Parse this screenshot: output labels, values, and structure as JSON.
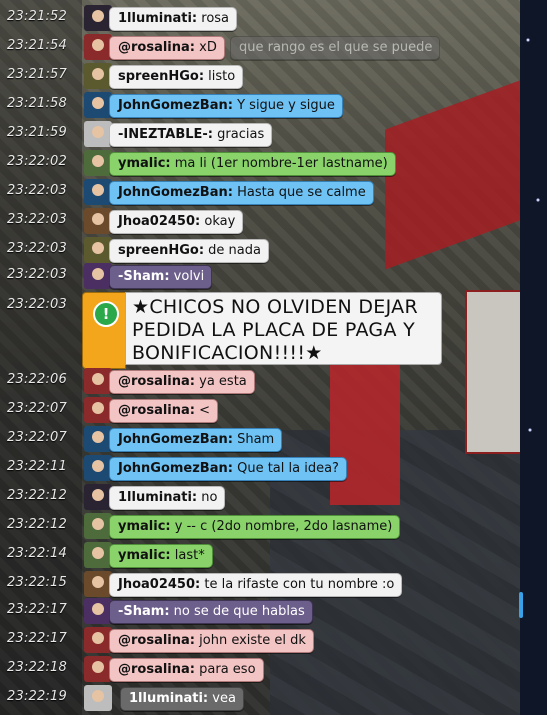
{
  "messages": [
    {
      "time": "23:21:52",
      "user": "1lluminati:",
      "text": "rosa",
      "color": "white"
    },
    {
      "time": "23:21:54",
      "user": "@rosalina:",
      "text": "xD",
      "color": "pink",
      "extra": "que rango es el que se puede"
    },
    {
      "time": "23:21:57",
      "user": "spreenHGo:",
      "text": "listo",
      "color": "white"
    },
    {
      "time": "23:21:58",
      "user": "JohnGomezBan:",
      "text": "Y sigue y sigue",
      "color": "blue"
    },
    {
      "time": "23:21:59",
      "user": "-INEZTABLE-:",
      "text": "gracias",
      "color": "white"
    },
    {
      "time": "23:22:02",
      "user": "ymalic:",
      "text": "ma li (1er nombre-1er lastname)",
      "color": "green"
    },
    {
      "time": "23:22:03",
      "user": "JohnGomezBan:",
      "text": "Hasta que se calme",
      "color": "blue"
    },
    {
      "time": "23:22:03",
      "user": "Jhoa02450:",
      "text": "okay",
      "color": "white"
    },
    {
      "time": "23:22:03",
      "user": "spreenHGo:",
      "text": "de nada",
      "color": "white"
    },
    {
      "time": "23:22:03",
      "user": "-Sham:",
      "text": "volvi",
      "color": "purple"
    }
  ],
  "alert": {
    "time": "23:22:03",
    "icon": "exclamation-icon",
    "text": "★CHICOS NO OLVIDEN DEJAR PEDIDA LA PLACA DE PAGA Y BONIFICACION!!!!★"
  },
  "messages2": [
    {
      "time": "23:22:06",
      "user": "@rosalina:",
      "text": "ya esta",
      "color": "pink"
    },
    {
      "time": "23:22:07",
      "user": "@rosalina:",
      "text": "<",
      "color": "pink"
    },
    {
      "time": "23:22:07",
      "user": "JohnGomezBan:",
      "text": "Sham",
      "color": "blue"
    },
    {
      "time": "23:22:11",
      "user": "JohnGomezBan:",
      "text": "Que tal la idea?",
      "color": "blue"
    },
    {
      "time": "23:22:12",
      "user": "1lluminati:",
      "text": "no",
      "color": "white"
    },
    {
      "time": "23:22:12",
      "user": "ymalic:",
      "text": "y -- c (2do nombre, 2do lasname)",
      "color": "green"
    },
    {
      "time": "23:22:14",
      "user": "ymalic:",
      "text": "last*",
      "color": "green"
    },
    {
      "time": "23:22:15",
      "user": "Jhoa02450:",
      "text": "te la rifaste con tu nombre :o",
      "color": "white"
    },
    {
      "time": "23:22:17",
      "user": "-Sham:",
      "text": "no se de que hablas",
      "color": "purple"
    },
    {
      "time": "23:22:17",
      "user": "@rosalina:",
      "text": "john existe el dk",
      "color": "pink"
    },
    {
      "time": "23:22:18",
      "user": "@rosalina:",
      "text": "para eso",
      "color": "pink"
    },
    {
      "time": "23:22:19",
      "user": "1lluminati:",
      "text": "vea",
      "color": "gray"
    }
  ]
}
